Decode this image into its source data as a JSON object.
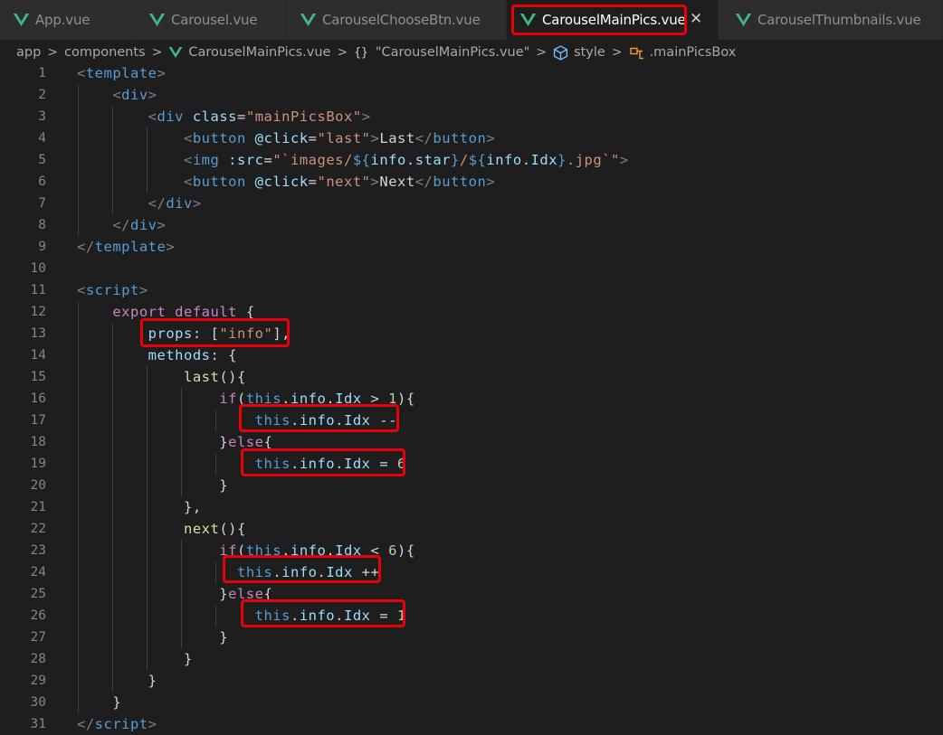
{
  "tabs": [
    {
      "label": "App.vue",
      "active": false
    },
    {
      "label": "Carousel.vue",
      "active": false
    },
    {
      "label": "CarouselChooseBtn.vue",
      "active": false
    },
    {
      "label": "CarouselMainPics.vue",
      "active": true
    },
    {
      "label": "CarouselThumbnails.vue",
      "active": false
    }
  ],
  "tab_close_glyph": "✕",
  "breadcrumb": {
    "items": [
      "app",
      "components",
      "CarouselMainPics.vue",
      "\"CarouselMainPics.vue\"",
      "style",
      ".mainPicsBox"
    ],
    "separator": ">",
    "braces": "{}"
  },
  "colors": {
    "editor_background": "#1e1e1e",
    "tab_bar_background": "#252526",
    "highlight": "#e8000b",
    "vue_icon": "#41b883"
  },
  "code_lines": [
    {
      "n": 1,
      "parts": [
        [
          "tk-br",
          "<"
        ],
        [
          "tk-tag",
          "template"
        ],
        [
          "tk-br",
          ">"
        ]
      ]
    },
    {
      "n": 2,
      "parts": [
        [
          "tk-br",
          "    <"
        ],
        [
          "tk-tag",
          "div"
        ],
        [
          "tk-br",
          ">"
        ]
      ]
    },
    {
      "n": 3,
      "parts": [
        [
          "tk-br",
          "        <"
        ],
        [
          "tk-tag",
          "div"
        ],
        [
          "tk-punc",
          " "
        ],
        [
          "tk-attr",
          "class"
        ],
        [
          "tk-punc",
          "="
        ],
        [
          "tk-str",
          "\"mainPicsBox\""
        ],
        [
          "tk-br",
          ">"
        ]
      ]
    },
    {
      "n": 4,
      "parts": [
        [
          "tk-br",
          "            <"
        ],
        [
          "tk-tag",
          "button"
        ],
        [
          "tk-punc",
          " "
        ],
        [
          "tk-attr",
          "@click"
        ],
        [
          "tk-punc",
          "="
        ],
        [
          "tk-str",
          "\"last\""
        ],
        [
          "tk-br",
          ">"
        ],
        [
          "tk-punc",
          "Last"
        ],
        [
          "tk-br",
          "</"
        ],
        [
          "tk-tag",
          "button"
        ],
        [
          "tk-br",
          ">"
        ]
      ]
    },
    {
      "n": 5,
      "parts": [
        [
          "tk-br",
          "            <"
        ],
        [
          "tk-tag",
          "img"
        ],
        [
          "tk-punc",
          " "
        ],
        [
          "tk-attr",
          ":src"
        ],
        [
          "tk-punc",
          "="
        ],
        [
          "tk-str",
          "\"`images/"
        ],
        [
          "tk-kw",
          "${"
        ],
        [
          "tk-prop",
          "info"
        ],
        [
          "tk-punc",
          "."
        ],
        [
          "tk-prop",
          "star"
        ],
        [
          "tk-kw",
          "}"
        ],
        [
          "tk-str",
          "/"
        ],
        [
          "tk-kw",
          "${"
        ],
        [
          "tk-prop",
          "info"
        ],
        [
          "tk-punc",
          "."
        ],
        [
          "tk-prop",
          "Idx"
        ],
        [
          "tk-kw",
          "}"
        ],
        [
          "tk-str",
          ".jpg`\""
        ],
        [
          "tk-br",
          ">"
        ]
      ]
    },
    {
      "n": 6,
      "parts": [
        [
          "tk-br",
          "            <"
        ],
        [
          "tk-tag",
          "button"
        ],
        [
          "tk-punc",
          " "
        ],
        [
          "tk-attr",
          "@click"
        ],
        [
          "tk-punc",
          "="
        ],
        [
          "tk-str",
          "\"next\""
        ],
        [
          "tk-br",
          ">"
        ],
        [
          "tk-punc",
          "Next"
        ],
        [
          "tk-br",
          "</"
        ],
        [
          "tk-tag",
          "button"
        ],
        [
          "tk-br",
          ">"
        ]
      ]
    },
    {
      "n": 7,
      "parts": [
        [
          "tk-br",
          "        </"
        ],
        [
          "tk-tag",
          "div"
        ],
        [
          "tk-br",
          ">"
        ]
      ]
    },
    {
      "n": 8,
      "parts": [
        [
          "tk-br",
          "    </"
        ],
        [
          "tk-tag",
          "div"
        ],
        [
          "tk-br",
          ">"
        ]
      ]
    },
    {
      "n": 9,
      "parts": [
        [
          "tk-br",
          "</"
        ],
        [
          "tk-tag",
          "template"
        ],
        [
          "tk-br",
          ">"
        ]
      ]
    },
    {
      "n": 10,
      "parts": []
    },
    {
      "n": 11,
      "parts": [
        [
          "tk-br",
          "<"
        ],
        [
          "tk-tag",
          "script"
        ],
        [
          "tk-br",
          ">"
        ]
      ]
    },
    {
      "n": 12,
      "parts": [
        [
          "tk-punc",
          "    "
        ],
        [
          "tk-ctrl",
          "export"
        ],
        [
          "tk-punc",
          " "
        ],
        [
          "tk-ctrl",
          "default"
        ],
        [
          "tk-punc",
          " {"
        ]
      ]
    },
    {
      "n": 13,
      "parts": [
        [
          "tk-punc",
          "        "
        ],
        [
          "tk-prop",
          "props"
        ],
        [
          "tk-punc",
          ": ["
        ],
        [
          "tk-str",
          "\"info\""
        ],
        [
          "tk-punc",
          "],"
        ]
      ]
    },
    {
      "n": 14,
      "parts": [
        [
          "tk-punc",
          "        "
        ],
        [
          "tk-prop",
          "methods"
        ],
        [
          "tk-punc",
          ": {"
        ]
      ]
    },
    {
      "n": 15,
      "parts": [
        [
          "tk-punc",
          "            "
        ],
        [
          "tk-fn",
          "last"
        ],
        [
          "tk-punc",
          "(){"
        ]
      ]
    },
    {
      "n": 16,
      "parts": [
        [
          "tk-punc",
          "                "
        ],
        [
          "tk-ctrl",
          "if"
        ],
        [
          "tk-punc",
          "("
        ],
        [
          "tk-this",
          "this"
        ],
        [
          "tk-punc",
          "."
        ],
        [
          "tk-prop",
          "info"
        ],
        [
          "tk-punc",
          "."
        ],
        [
          "tk-prop",
          "Idx"
        ],
        [
          "tk-punc",
          " > "
        ],
        [
          "tk-num",
          "1"
        ],
        [
          "tk-punc",
          "){"
        ]
      ]
    },
    {
      "n": 17,
      "parts": [
        [
          "tk-punc",
          "                    "
        ],
        [
          "tk-this",
          "this"
        ],
        [
          "tk-punc",
          "."
        ],
        [
          "tk-prop",
          "info"
        ],
        [
          "tk-punc",
          "."
        ],
        [
          "tk-prop",
          "Idx"
        ],
        [
          "tk-punc",
          " --"
        ]
      ]
    },
    {
      "n": 18,
      "parts": [
        [
          "tk-punc",
          "                }"
        ],
        [
          "tk-ctrl",
          "else"
        ],
        [
          "tk-punc",
          "{"
        ]
      ]
    },
    {
      "n": 19,
      "parts": [
        [
          "tk-punc",
          "                    "
        ],
        [
          "tk-this",
          "this"
        ],
        [
          "tk-punc",
          "."
        ],
        [
          "tk-prop",
          "info"
        ],
        [
          "tk-punc",
          "."
        ],
        [
          "tk-prop",
          "Idx"
        ],
        [
          "tk-punc",
          " = "
        ],
        [
          "tk-num",
          "6"
        ]
      ]
    },
    {
      "n": 20,
      "parts": [
        [
          "tk-punc",
          "                }"
        ]
      ]
    },
    {
      "n": 21,
      "parts": [
        [
          "tk-punc",
          "            },"
        ]
      ]
    },
    {
      "n": 22,
      "parts": [
        [
          "tk-punc",
          "            "
        ],
        [
          "tk-fn",
          "next"
        ],
        [
          "tk-punc",
          "(){"
        ]
      ]
    },
    {
      "n": 23,
      "parts": [
        [
          "tk-punc",
          "                "
        ],
        [
          "tk-ctrl",
          "if"
        ],
        [
          "tk-punc",
          "("
        ],
        [
          "tk-this",
          "this"
        ],
        [
          "tk-punc",
          "."
        ],
        [
          "tk-prop",
          "info"
        ],
        [
          "tk-punc",
          "."
        ],
        [
          "tk-prop",
          "Idx"
        ],
        [
          "tk-punc",
          " < "
        ],
        [
          "tk-num",
          "6"
        ],
        [
          "tk-punc",
          "){"
        ]
      ]
    },
    {
      "n": 24,
      "parts": [
        [
          "tk-punc",
          "                  "
        ],
        [
          "tk-this",
          "this"
        ],
        [
          "tk-punc",
          "."
        ],
        [
          "tk-prop",
          "info"
        ],
        [
          "tk-punc",
          "."
        ],
        [
          "tk-prop",
          "Idx"
        ],
        [
          "tk-punc",
          " ++"
        ]
      ]
    },
    {
      "n": 25,
      "parts": [
        [
          "tk-punc",
          "                }"
        ],
        [
          "tk-ctrl",
          "else"
        ],
        [
          "tk-punc",
          "{"
        ]
      ]
    },
    {
      "n": 26,
      "parts": [
        [
          "tk-punc",
          "                    "
        ],
        [
          "tk-this",
          "this"
        ],
        [
          "tk-punc",
          "."
        ],
        [
          "tk-prop",
          "info"
        ],
        [
          "tk-punc",
          "."
        ],
        [
          "tk-prop",
          "Idx"
        ],
        [
          "tk-punc",
          " = "
        ],
        [
          "tk-num",
          "1"
        ]
      ]
    },
    {
      "n": 27,
      "parts": [
        [
          "tk-punc",
          "                }"
        ]
      ]
    },
    {
      "n": 28,
      "parts": [
        [
          "tk-punc",
          "            }"
        ]
      ]
    },
    {
      "n": 29,
      "parts": [
        [
          "tk-punc",
          "        }"
        ]
      ]
    },
    {
      "n": 30,
      "parts": [
        [
          "tk-punc",
          "    }"
        ]
      ]
    },
    {
      "n": 31,
      "parts": [
        [
          "tk-br",
          "</"
        ],
        [
          "tk-tag",
          "script"
        ],
        [
          "tk-br",
          ">"
        ]
      ]
    }
  ]
}
